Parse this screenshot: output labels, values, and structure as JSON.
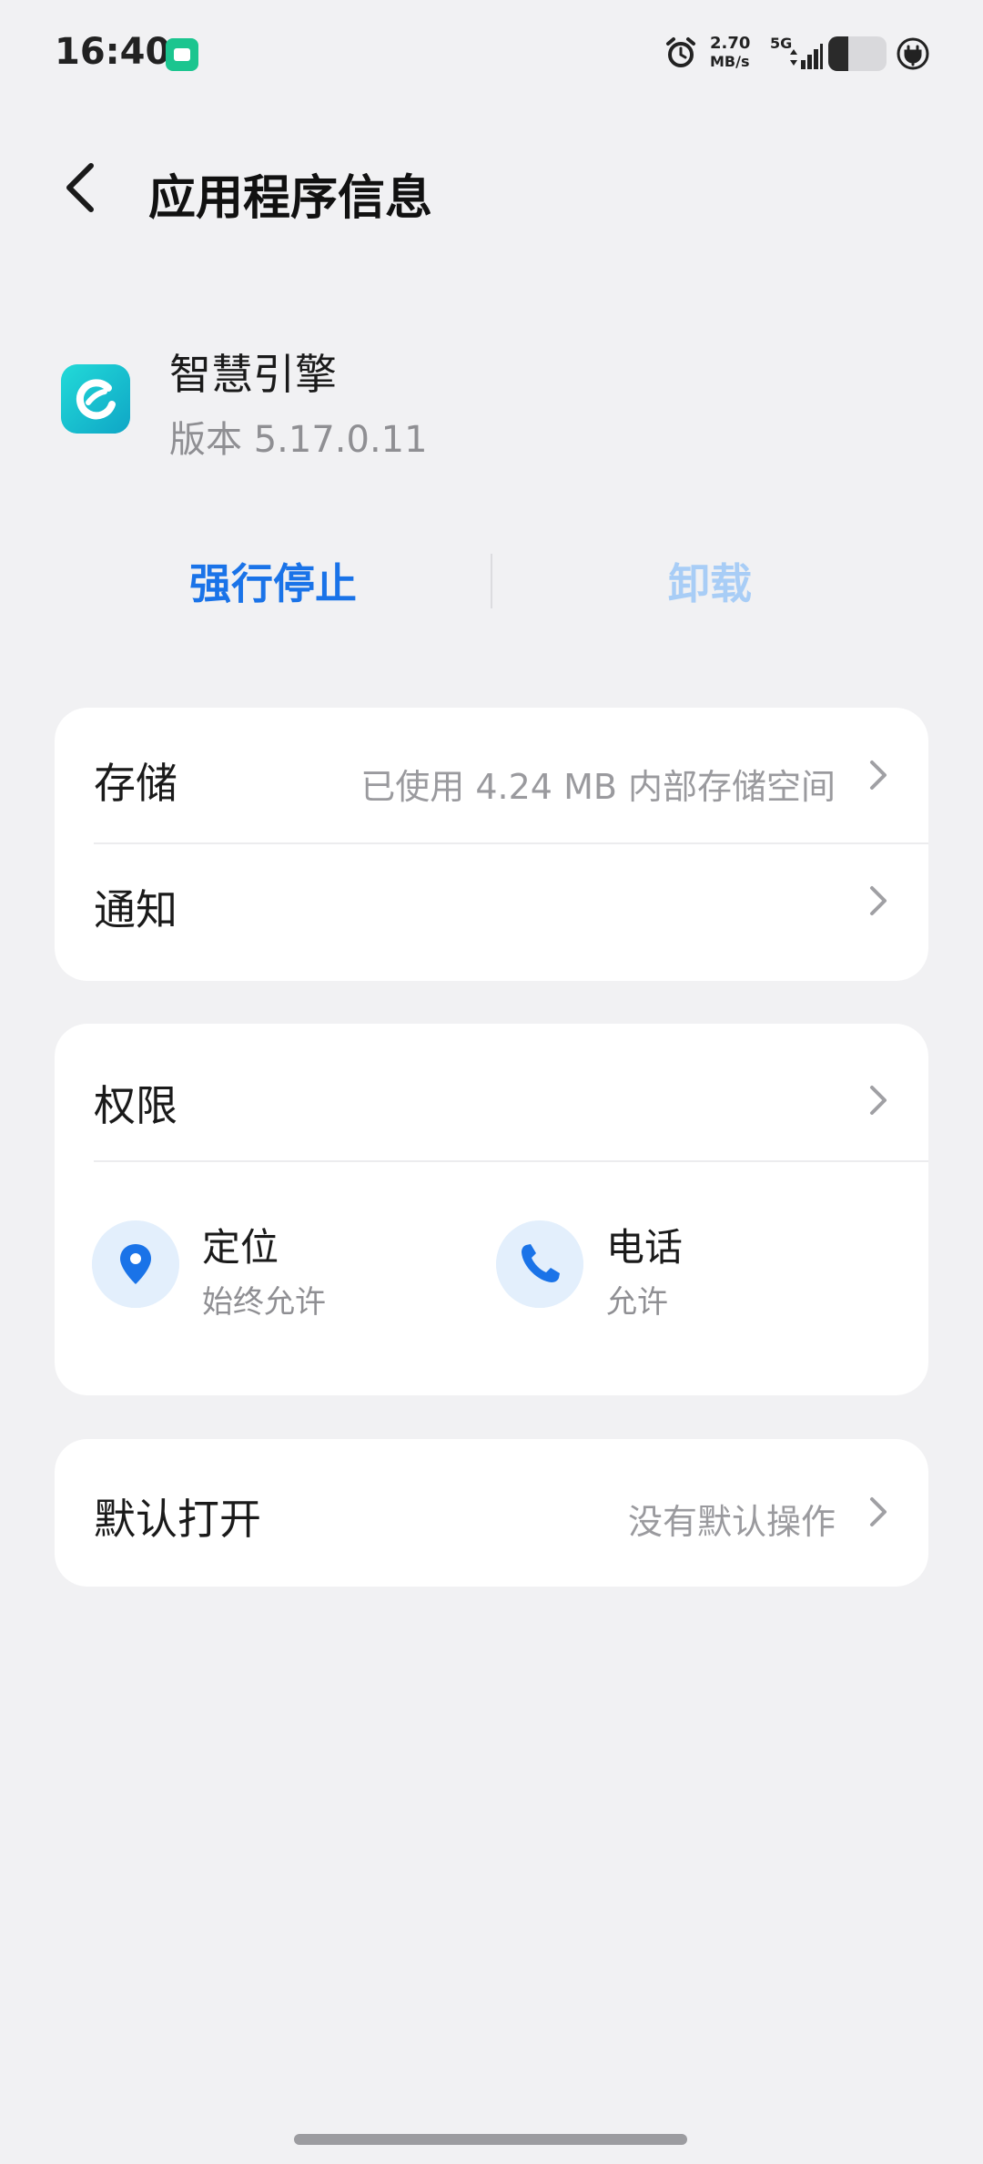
{
  "status_bar": {
    "time": "16:40",
    "net_speed_value": "2.70",
    "net_speed_unit": "MB/s",
    "network_type": "5G",
    "battery_level": 0.35,
    "icons": [
      "app-notification-icon",
      "alarm-icon",
      "signal-icon",
      "battery-icon",
      "charging-icon"
    ]
  },
  "header": {
    "title": "应用程序信息"
  },
  "app": {
    "name": "智慧引擎",
    "version": "版本 5.17.0.11",
    "icon_color": "#13c2cf"
  },
  "actions": {
    "force_stop": "强行停止",
    "uninstall": "卸载"
  },
  "storage_card": {
    "storage_label": "存储",
    "storage_value": "已使用 4.24 MB 内部存储空间",
    "notification_label": "通知"
  },
  "permissions_card": {
    "label": "权限",
    "items": [
      {
        "name": "定位",
        "status": "始终允许",
        "icon": "location-icon"
      },
      {
        "name": "电话",
        "status": "允许",
        "icon": "phone-icon"
      }
    ]
  },
  "default_card": {
    "label": "默认打开",
    "value": "没有默认操作"
  },
  "colors": {
    "accent": "#1a73e8",
    "accent_disabled": "#a8cdf6",
    "background": "#f1f1f3"
  }
}
